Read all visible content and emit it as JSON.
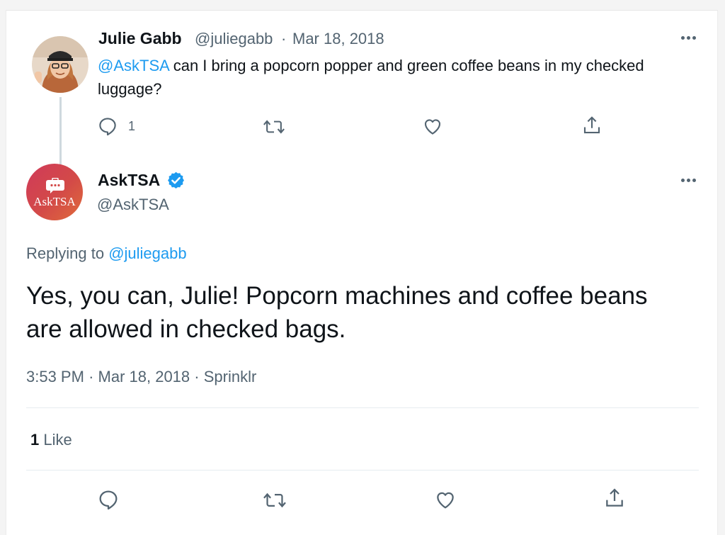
{
  "parent_tweet": {
    "author_name": "Julie Gabb",
    "handle": "@juliegabb",
    "separator": "·",
    "date": "Mar 18, 2018",
    "mention": "@AskTSA",
    "text": "can I bring a popcorn popper and green coffee beans in my checked luggage?",
    "reply_count": "1",
    "icons": [
      "reply-icon",
      "retweet-icon",
      "like-icon",
      "share-icon",
      "more-icon"
    ]
  },
  "main_tweet": {
    "author_name": "AskTSA",
    "handle": "@AskTSA",
    "avatar_text": "AskTSA",
    "replying_prefix": "Replying to",
    "replying_to": "@juliegabb",
    "text": "Yes, you can, Julie! Popcorn machines and coffee beans are allowed in checked bags.",
    "time": "3:53 PM",
    "separator": "·",
    "date": "Mar 18, 2018",
    "source": "Sprinklr",
    "like_count": "1",
    "like_label": "Like",
    "icons": [
      "verified-badge-icon",
      "reply-icon",
      "retweet-icon",
      "like-icon",
      "share-icon",
      "more-icon"
    ]
  },
  "colors": {
    "link": "#1d9bf0",
    "muted": "#536471",
    "text": "#0f1419",
    "avatar_gradient_start": "#d03a5a",
    "avatar_gradient_end": "#e06b3a"
  }
}
